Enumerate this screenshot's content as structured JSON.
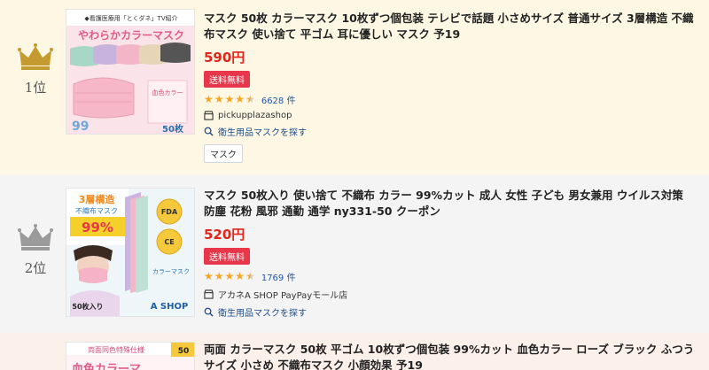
{
  "items": [
    {
      "rank_label": "1位",
      "title": "マスク 50枚 カラーマスク 10枚ずつ個包装 テレビで話題 小さめサイズ 普通サイズ 3層構造 不織布マスク 使い捨て 平ゴム 耳に優しい マスク 予19",
      "price": "590円",
      "shipping": "送料無料",
      "rating": 4.5,
      "review_count": "6628 件",
      "store": "pickupplazashop",
      "search_link": "衛生用品マスクを探す",
      "tag": "マスク",
      "thumb": {
        "banner": "◆看護医療用「とくダネ」TV紹介",
        "headline": "やわらかカラーマスク",
        "note": "血色カラー",
        "percent": "99",
        "count": "50枚"
      }
    },
    {
      "rank_label": "2位",
      "title": "マスク 50枚入り 使い捨て 不織布 カラー 99%カット 成人 女性 子ども 男女兼用 ウイルス対策 防塵 花粉 風邪 通勤 通学 ny331-50 クーポン",
      "price": "520円",
      "shipping": "送料無料",
      "rating": 4.5,
      "review_count": "1769 件",
      "store": "アカネA SHOP PayPayモール店",
      "search_link": "衛生用品マスクを探す",
      "thumb": {
        "headline": "3層構造",
        "sub": "不織布マスク",
        "percent": "99%",
        "badge1": "FDA",
        "badge2": "CE",
        "count": "50枚入り",
        "brand": "A SHOP",
        "desc": "カラーマスク"
      }
    },
    {
      "title": "両面 カラーマスク 50枚 平ゴム 10枚ずつ個包装 99%カット 血色カラー ローズ ブラック ふつうサイズ 小さめ 不織布マスク 小顔効果 予19",
      "thumb": {
        "headline": "血色カラーマ",
        "banner": "両面同色特殊仕様",
        "count": "50"
      }
    }
  ],
  "colors": {
    "price": "#e2241b",
    "shipping_badge": "#e8374b",
    "star": "#f5a623",
    "gold_crown": "#c59a2e",
    "silver_crown": "#9a9a9a",
    "link": "#2255aa"
  }
}
